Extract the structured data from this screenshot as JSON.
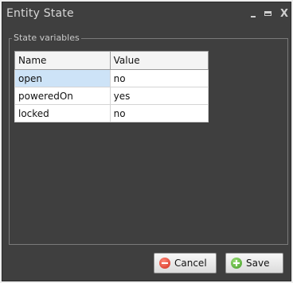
{
  "window": {
    "title": "Entity State",
    "buttons": {
      "minimize": "–",
      "maximize": "□",
      "close": "X"
    }
  },
  "group": {
    "label": "State variables"
  },
  "table": {
    "columns": [
      "Name",
      "Value"
    ],
    "rows": [
      {
        "name": "open",
        "value": "no",
        "selected": true
      },
      {
        "name": "poweredOn",
        "value": "yes",
        "selected": false
      },
      {
        "name": "locked",
        "value": "no",
        "selected": false
      }
    ]
  },
  "actions": {
    "cancel_label": "Cancel",
    "save_label": "Save"
  },
  "icons": {
    "cancel": "cancel-icon",
    "save": "save-icon"
  },
  "colors": {
    "window_bg": "#3f3f3f",
    "selected_cell": "#cde3f7"
  }
}
